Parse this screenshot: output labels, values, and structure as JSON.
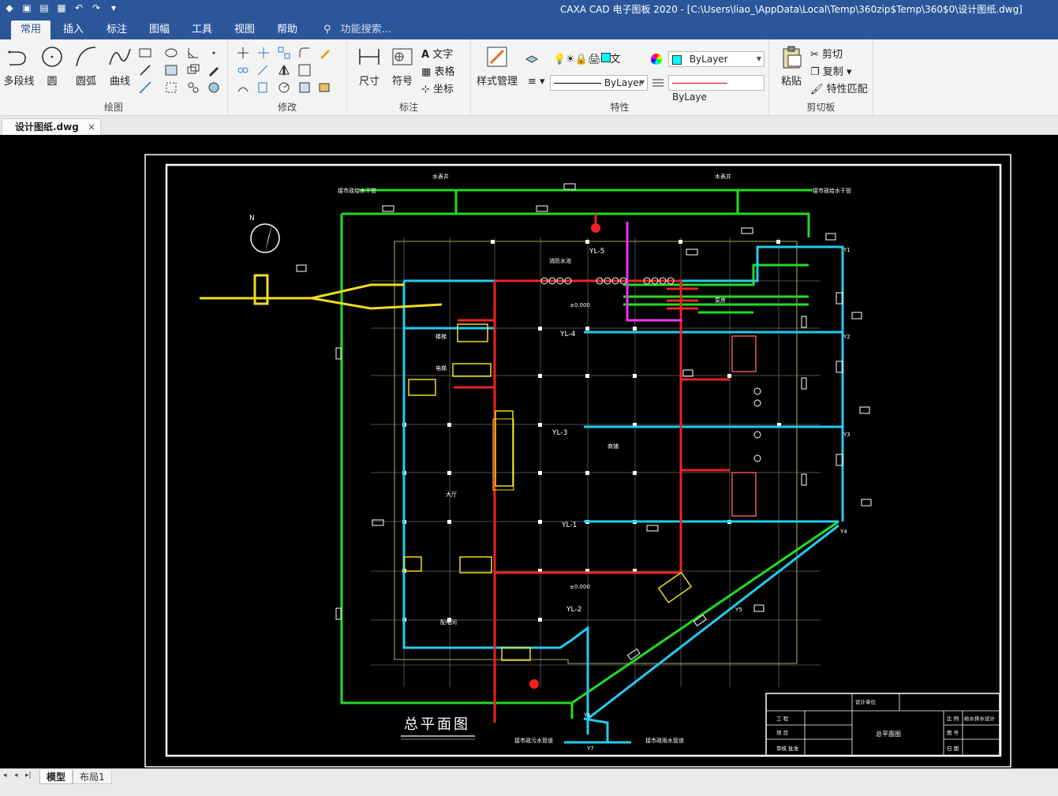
{
  "titlebar": {
    "title": "CAXA CAD 电子图板 2020 - [C:\\Users\\liao_\\AppData\\Local\\Temp\\360zip$Temp\\360$0\\设计图纸.dwg]"
  },
  "ribbon_tabs": [
    {
      "label": "常用",
      "active": true
    },
    {
      "label": "插入",
      "active": false
    },
    {
      "label": "标注",
      "active": false
    },
    {
      "label": "图幅",
      "active": false
    },
    {
      "label": "工具",
      "active": false
    },
    {
      "label": "视图",
      "active": false
    },
    {
      "label": "帮助",
      "active": false
    }
  ],
  "search": {
    "placeholder": "功能搜索..."
  },
  "groups": {
    "draw": {
      "label": "绘图",
      "polyline": "多段线",
      "circle": "圆",
      "arc": "圆弧",
      "curve": "曲线"
    },
    "modify": {
      "label": "修改"
    },
    "annotate": {
      "label": "标注",
      "dimension": "尺寸",
      "symbol": "符号",
      "text": "文字",
      "table": "表格",
      "coordinate": "坐标"
    },
    "properties": {
      "label": "特性",
      "style_manager": "样式管理",
      "layer_text": "文",
      "color_value": "ByLayer",
      "linetype_value": "ByLayer",
      "lineweight_value": "ByLaye"
    },
    "clipboard": {
      "label": "剪切板",
      "paste": "粘贴",
      "cut": "剪切",
      "copy": "复制",
      "match": "特性匹配"
    }
  },
  "document_tab": {
    "name": "设计图纸.dwg",
    "close": "×"
  },
  "layout_tabs": [
    {
      "label": "模型",
      "active": true
    },
    {
      "label": "布局1",
      "active": false
    }
  ],
  "drawing": {
    "title": "总平面图",
    "labels": {
      "north": "N",
      "water_main_1": "接市政给水干管",
      "water_main_2": "接市政给水干管",
      "meter_1": "水表井",
      "meter_2": "水表井",
      "pump_room": "泵房",
      "tank": "消防水池",
      "elev1": "±0.000",
      "elev2": "±0.000",
      "yl5": "YL-5",
      "yl4": "YL-4",
      "yl3": "YL-3",
      "yl1": "YL-1",
      "yl2": "YL-2",
      "shop": "商铺",
      "hall": "大厅",
      "room_a": "楼梯",
      "room_b": "电梯",
      "room_c": "配电间",
      "sewer_1": "接市政污水管道",
      "sewer_2": "接市政雨水管道",
      "y1": "Y1",
      "y2": "Y2",
      "y3": "Y3",
      "y4": "Y4",
      "y5": "Y5",
      "y6": "Y6",
      "y7": "Y7"
    },
    "title_block": {
      "designer": "设计单位",
      "project": "工 程",
      "item": "项 目",
      "drawing_name": "总平面图",
      "discipline": "给水排水设计",
      "scale": "比 例",
      "sheet": "图 号",
      "date": "日 期",
      "approval": "审核 批准",
      "review": "审 核"
    }
  }
}
